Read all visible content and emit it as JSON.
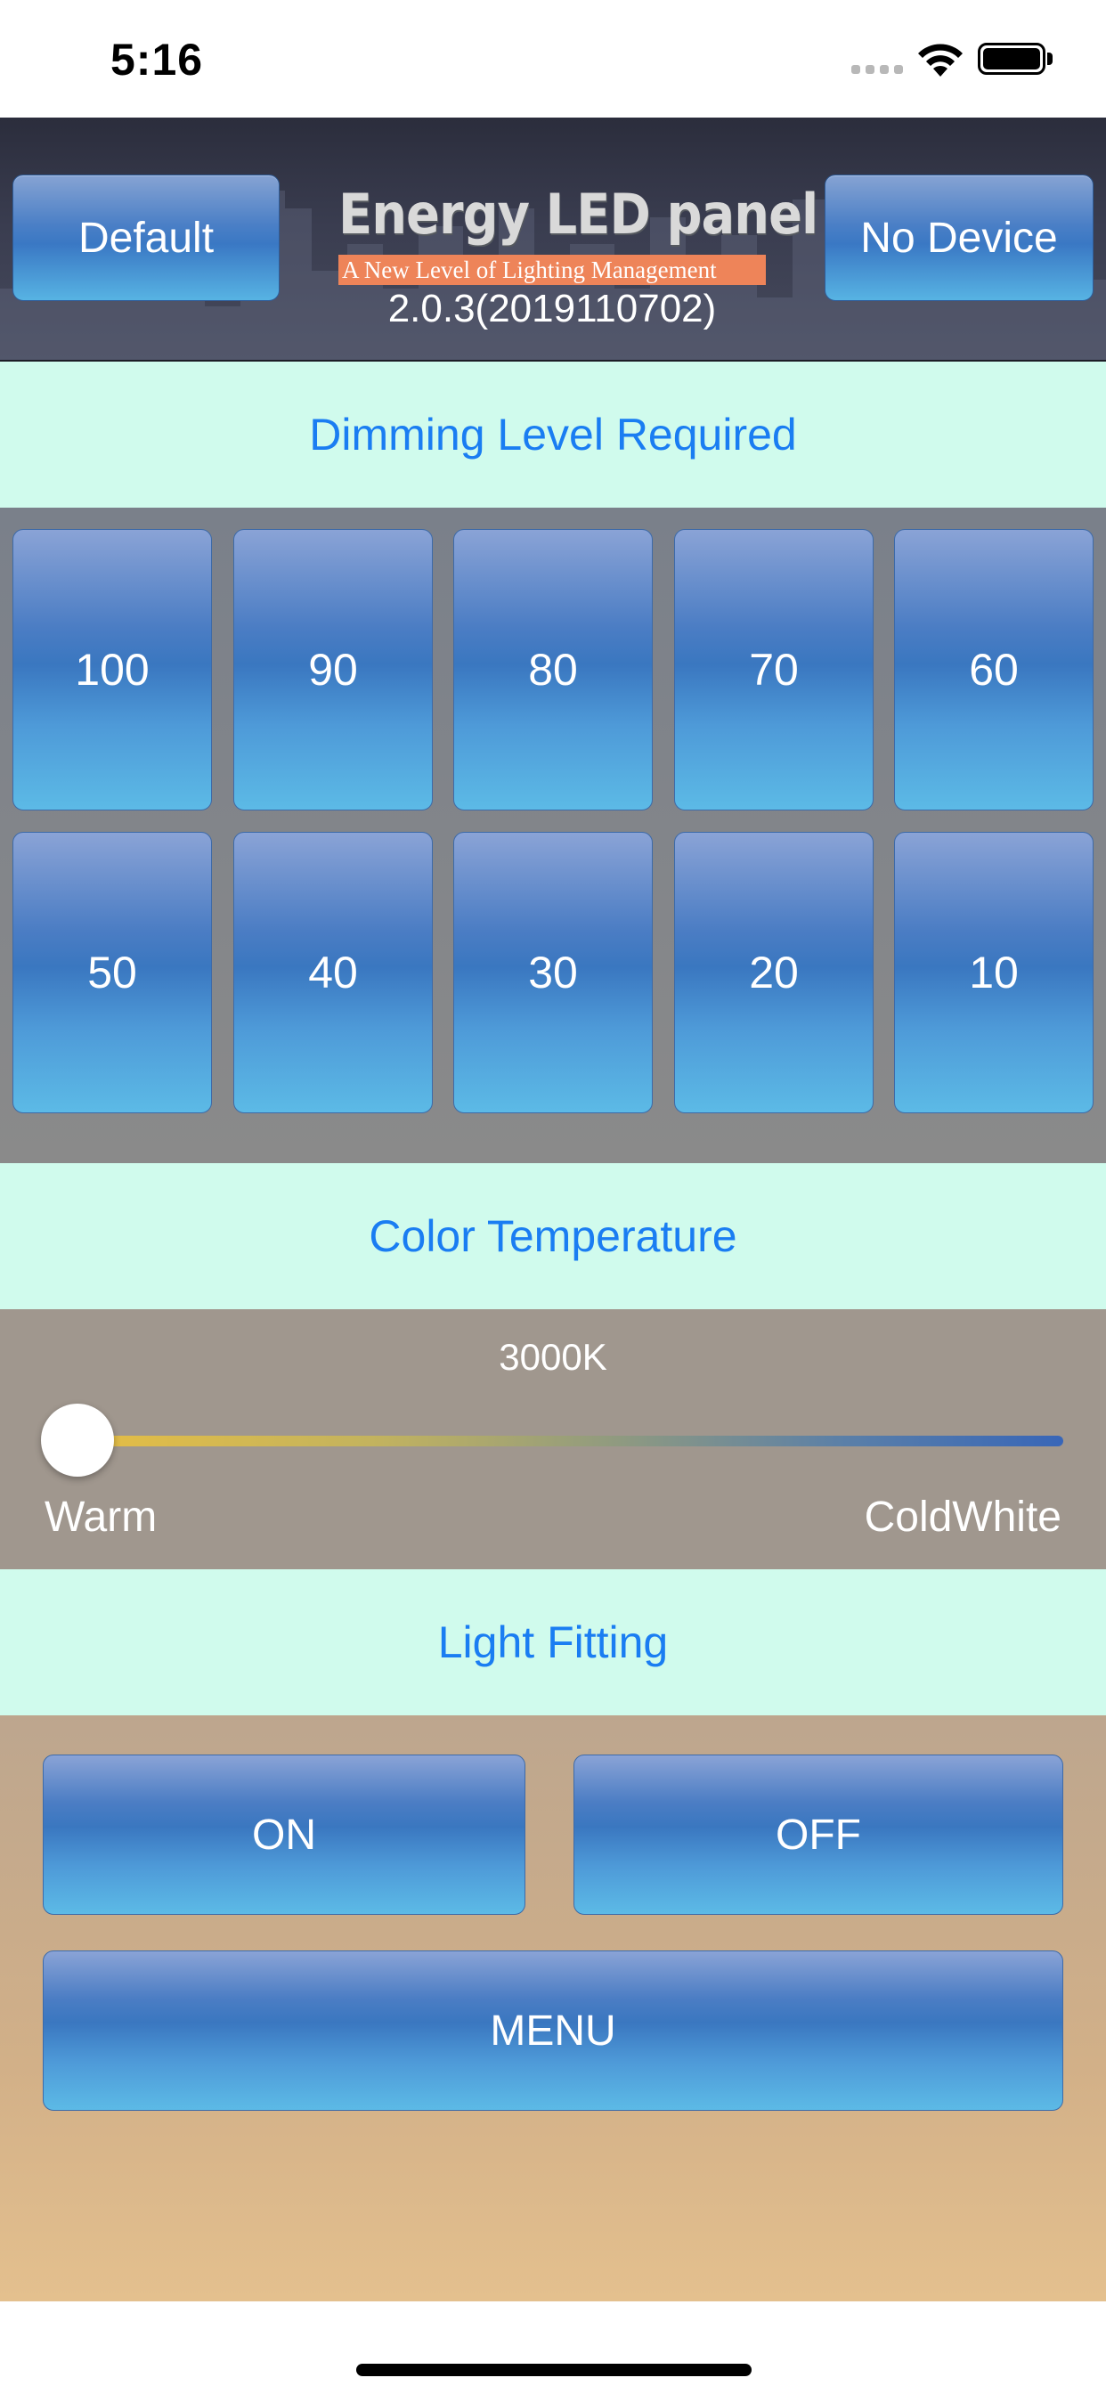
{
  "status_bar": {
    "time": "5:16"
  },
  "header": {
    "default_label": "Default",
    "device_label": "No Device",
    "logo_title": "Energy LED panel",
    "logo_subtitle": "A New Level of Lighting Management",
    "version": "2.0.3(2019110702)"
  },
  "dimming": {
    "label": "Dimming Level Required",
    "levels": [
      "100",
      "90",
      "80",
      "70",
      "60",
      "50",
      "40",
      "30",
      "20",
      "10"
    ]
  },
  "color_temperature": {
    "label": "Color Temperature",
    "value": "3000K",
    "slider_position": 0.0,
    "min_label": "Warm",
    "max_label": "ColdWhite"
  },
  "light_fitting": {
    "label": "Light Fitting",
    "on_label": "ON",
    "off_label": "OFF",
    "menu_label": "MENU"
  },
  "colors": {
    "section_label_bg": "#d0fbed",
    "section_label_text": "#1a7df2",
    "button_blue": "#3a77c0"
  }
}
